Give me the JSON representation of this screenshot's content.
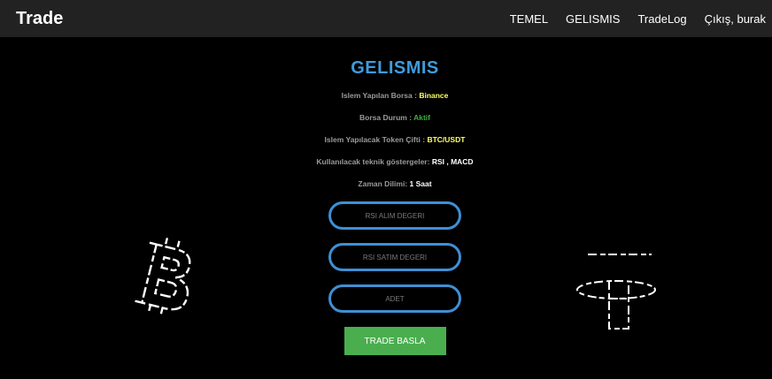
{
  "navbar": {
    "brand": "Trade",
    "links": [
      "TEMEL",
      "GELISMIS",
      "TradeLog",
      "Çıkış, burak"
    ]
  },
  "main": {
    "title": "GELISMIS",
    "info": [
      {
        "label": "Islem Yapılan Borsa : ",
        "value": "Binance",
        "value_color": "#ffff66"
      },
      {
        "label": "Borsa Durum : ",
        "value": "Aktif",
        "value_color": "#3fae3f"
      },
      {
        "label": "Islem Yapılacak Token Çifti : ",
        "value": "BTC/USDT",
        "value_color": "#ffff66"
      },
      {
        "label": "Kullanılacak teknik göstergeler: ",
        "value": "RSI , MACD",
        "value_color": "#ffffff"
      },
      {
        "label": "Zaman Dilimi: ",
        "value": "1 Saat",
        "value_color": "#ffffff"
      }
    ],
    "inputs": [
      {
        "placeholder": "RSI ALIM DEGERI"
      },
      {
        "placeholder": "RSI SATIM DEGERI"
      },
      {
        "placeholder": "ADET"
      }
    ],
    "button_label": "TRADE BASLA"
  },
  "colors": {
    "accent": "#3f9bdc",
    "button": "#4aae4f",
    "navbar": "#222222"
  },
  "decorations": {
    "left_icon": "bitcoin-logo-icon",
    "right_icon": "tether-logo-icon"
  }
}
